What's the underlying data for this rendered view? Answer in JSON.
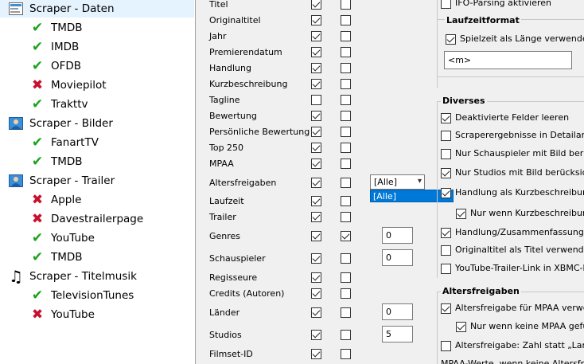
{
  "tree": [
    {
      "label": "Scraper - Daten",
      "icon": "scraper-icon",
      "level": 0,
      "selected": true
    },
    {
      "label": "TMDB",
      "icon": "checkmark-icon",
      "level": 1
    },
    {
      "label": "IMDB",
      "icon": "checkmark-icon",
      "level": 1
    },
    {
      "label": "OFDB",
      "icon": "checkmark-icon",
      "level": 1
    },
    {
      "label": "Moviepilot",
      "icon": "cross-icon",
      "level": 1
    },
    {
      "label": "Trakttv",
      "icon": "checkmark-icon",
      "level": 1
    },
    {
      "label": "Scraper - Bilder",
      "icon": "person-image-icon",
      "level": 0
    },
    {
      "label": "FanartTV",
      "icon": "checkmark-icon",
      "level": 1
    },
    {
      "label": "TMDB",
      "icon": "checkmark-icon",
      "level": 1
    },
    {
      "label": "Scraper - Trailer",
      "icon": "person-image-icon",
      "level": 0
    },
    {
      "label": "Apple",
      "icon": "cross-icon",
      "level": 1
    },
    {
      "label": "Davestrailerpage",
      "icon": "cross-icon",
      "level": 1
    },
    {
      "label": "YouTube",
      "icon": "checkmark-icon",
      "level": 1
    },
    {
      "label": "TMDB",
      "icon": "checkmark-icon",
      "level": 1
    },
    {
      "label": "Scraper - Titelmusik",
      "icon": "music-note-icon",
      "level": 0
    },
    {
      "label": "TelevisionTunes",
      "icon": "checkmark-icon",
      "level": 1
    },
    {
      "label": "YouTube",
      "icon": "cross-icon",
      "level": 1
    }
  ],
  "fields": [
    {
      "label": "Titel",
      "c1": true,
      "c2": false
    },
    {
      "label": "Originaltitel",
      "c1": true,
      "c2": false
    },
    {
      "label": "Jahr",
      "c1": true,
      "c2": false
    },
    {
      "label": "Premierendatum",
      "c1": true,
      "c2": false
    },
    {
      "label": "Handlung",
      "c1": true,
      "c2": false
    },
    {
      "label": "Kurzbeschreibung",
      "c1": true,
      "c2": false
    },
    {
      "label": "Tagline",
      "c1": false,
      "c2": false
    },
    {
      "label": "Bewertung",
      "c1": true,
      "c2": false
    },
    {
      "label": "Persönliche Bewertung",
      "c1": true,
      "c2": false
    },
    {
      "label": "Top 250",
      "c1": true,
      "c2": false
    },
    {
      "label": "MPAA",
      "c1": true,
      "c2": false
    },
    {
      "label": "Altersfreigaben",
      "c1": true,
      "c2": false,
      "combo": "[Alle]"
    },
    {
      "label": "Laufzeit",
      "c1": true,
      "c2": false
    },
    {
      "label": "Trailer",
      "c1": true,
      "c2": false
    },
    {
      "label": "Genres",
      "c1": true,
      "c2": true,
      "num": "0"
    },
    {
      "label": "Schauspieler",
      "c1": true,
      "c2": false,
      "num": "0"
    },
    {
      "label": "Regisseure",
      "c1": true,
      "c2": false
    },
    {
      "label": "Credits (Autoren)",
      "c1": true,
      "c2": false
    },
    {
      "label": "Länder",
      "c1": true,
      "c2": false,
      "num": "0"
    },
    {
      "label": "Studios",
      "c1": true,
      "c2": false,
      "num": "5"
    },
    {
      "label": "Filmset-ID",
      "c1": true,
      "c2": false
    }
  ],
  "combo": {
    "value": "[Alle]",
    "options": [
      "[Alle]"
    ]
  },
  "right": {
    "ifo": {
      "label": "IFO-Parsing aktivieren",
      "checked": false
    },
    "laufzeit_title": "Laufzeitformat",
    "spielzeit": {
      "label": "Spielzeit als Länge verwenden",
      "checked": true
    },
    "format_value": "<m>",
    "diverses_title": "Diverses",
    "diverses": [
      {
        "label": "Deaktivierte Felder leeren",
        "checked": true,
        "indent": false
      },
      {
        "label": "Scraperergebnisse in Detailansi",
        "checked": false,
        "indent": false
      },
      {
        "label": "Nur Schauspieler mit Bild berück",
        "checked": false,
        "indent": false
      },
      {
        "label": "Nur Studios mit Bild berücksicht",
        "checked": true,
        "indent": false
      },
      {
        "label": "Handlung als Kurzbeschreibung",
        "checked": true,
        "indent": false
      },
      {
        "label": "Nur wenn Kurzbeschreibung",
        "checked": true,
        "indent": true
      },
      {
        "label": "Handlung/Zusammenfassung b",
        "checked": true,
        "indent": false
      },
      {
        "label": "Originaltitel als Titel verwenden",
        "checked": false,
        "indent": false
      },
      {
        "label": "YouTube-Trailer-Link in XBMC-ko",
        "checked": false,
        "indent": false
      }
    ],
    "alters_title": "Altersfreigaben",
    "alters": [
      {
        "label": "Altersfreigabe für MPAA verwen",
        "checked": true,
        "indent": false
      },
      {
        "label": "Nur wenn keine MPAA gefu",
        "checked": true,
        "indent": true
      },
      {
        "label": "Altersfreigabe: Zahl statt „Land:",
        "checked": false,
        "indent": false
      }
    ],
    "bottom_text": "MPAA-Werte, wenn keine Altersfrei"
  }
}
